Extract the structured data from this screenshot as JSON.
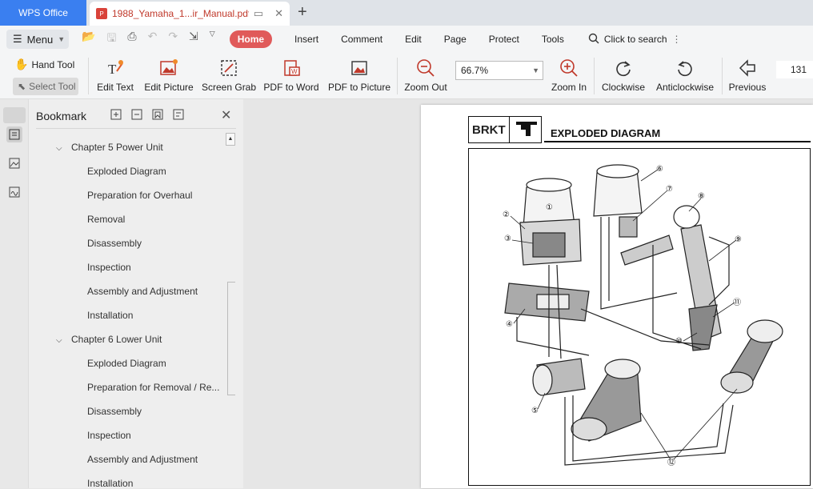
{
  "tabs": {
    "app": "WPS Office",
    "document": "1988_Yamaha_1...ir_Manual.pdf"
  },
  "menubar": {
    "menu_label": "Menu",
    "items": [
      "Home",
      "Insert",
      "Comment",
      "Edit",
      "Page",
      "Protect",
      "Tools"
    ],
    "search": "Click to search"
  },
  "ribbon": {
    "hand_tool": "Hand Tool",
    "select_tool": "Select Tool",
    "edit_text": "Edit Text",
    "edit_picture": "Edit Picture",
    "screen_grab": "Screen Grab",
    "pdf_to_word": "PDF to Word",
    "pdf_to_picture": "PDF to Picture",
    "zoom_out": "Zoom Out",
    "zoom_value": "66.7%",
    "zoom_in": "Zoom In",
    "clockwise": "Clockwise",
    "anticlockwise": "Anticlockwise",
    "previous": "Previous",
    "page_number": "131"
  },
  "bookmark": {
    "title": "Bookmark",
    "chapter5": "Chapter 5 Power Unit",
    "ch5_items": [
      "Exploded Diagram",
      "Preparation for Overhaul",
      "Removal",
      "Disassembly",
      "Inspection",
      "Assembly and Adjustment",
      "Installation"
    ],
    "chapter6": "Chapter 6 Lower Unit",
    "ch6_items": [
      "Exploded Diagram",
      "Preparation for Removal / Re...",
      "Disassembly",
      "Inspection",
      "Assembly and Adjustment",
      "Installation"
    ]
  },
  "doc": {
    "section_code": "BRKT",
    "title": "EXPLODED DIAGRAM",
    "callouts": [
      "①",
      "②",
      "③",
      "④",
      "⑤",
      "⑥",
      "⑦",
      "⑧",
      "⑨",
      "⑩",
      "⑪",
      "⑫"
    ]
  },
  "colors": {
    "accent": "#3a7ff0",
    "home": "#e05a5a",
    "doc_tab_text": "#c0392b"
  }
}
